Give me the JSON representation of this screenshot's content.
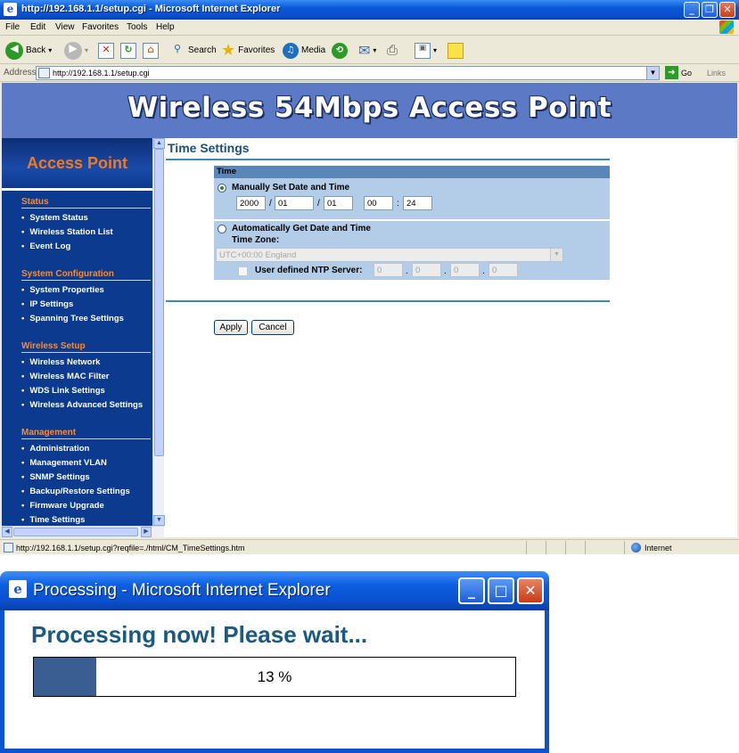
{
  "browser": {
    "title": "http://192.168.1.1/setup.cgi - Microsoft Internet Explorer",
    "menu": [
      "File",
      "Edit",
      "View",
      "Favorites",
      "Tools",
      "Help"
    ],
    "toolbar": {
      "back": "Back",
      "search": "Search",
      "favorites": "Favorites",
      "media": "Media"
    },
    "address_label": "Address",
    "address": "http://192.168.1.1/setup.cgi",
    "go": "Go",
    "links": "Links",
    "status_url": "http://192.168.1.1/setup.cgi?reqfile=./html/CM_TimeSettings.htm",
    "status_zone": "Internet"
  },
  "banner": {
    "title": "Wireless 54Mbps Access Point"
  },
  "nav": {
    "header": "Access Point",
    "sections": [
      {
        "title": "Status",
        "items": [
          "System Status",
          "Wireless Station List",
          "Event Log"
        ]
      },
      {
        "title": "System Configuration",
        "items": [
          "System Properties",
          "IP Settings",
          "Spanning Tree Settings"
        ]
      },
      {
        "title": "Wireless Setup",
        "items": [
          "Wireless Network",
          "Wireless MAC Filter",
          "WDS Link Settings",
          "Wireless Advanced Settings"
        ]
      },
      {
        "title": "Management",
        "items": [
          "Administration",
          "Management VLAN",
          "SNMP Settings",
          "Backup/Restore Settings",
          "Firmware Upgrade",
          "Time Settings"
        ]
      }
    ]
  },
  "main": {
    "page_title": "Time Settings",
    "box_header": "Time",
    "manual_label": "Manually Set Date and Time",
    "manual": {
      "year": "2000",
      "month": "01",
      "day": "01",
      "hour": "00",
      "minute": "24",
      "sep_date": "/",
      "sep_time": ":"
    },
    "auto_label": "Automatically Get Date and Time",
    "timezone_label": "Time Zone:",
    "timezone_value": "UTC+00:00 England",
    "ntp_label": "User defined NTP Server:",
    "ntp": [
      "0",
      "0",
      "0",
      "0"
    ],
    "ntp_sep": ".",
    "apply": "Apply",
    "cancel": "Cancel"
  },
  "dialog": {
    "title": "Processing - Microsoft Internet Explorer",
    "message": "Processing now! Please wait...",
    "progress": 13,
    "progress_label": "13 %"
  },
  "colors": {
    "banner": "#5b79c4",
    "nav_bg": "#0b3a8e",
    "nav_section": "#ff8a2a",
    "nav_header": "#f07a1c",
    "box_bg": "#b3cce8",
    "box_header": "#5a86b8",
    "progress_fill": "#3a5e91",
    "xp_blue": "#0a58d8"
  }
}
